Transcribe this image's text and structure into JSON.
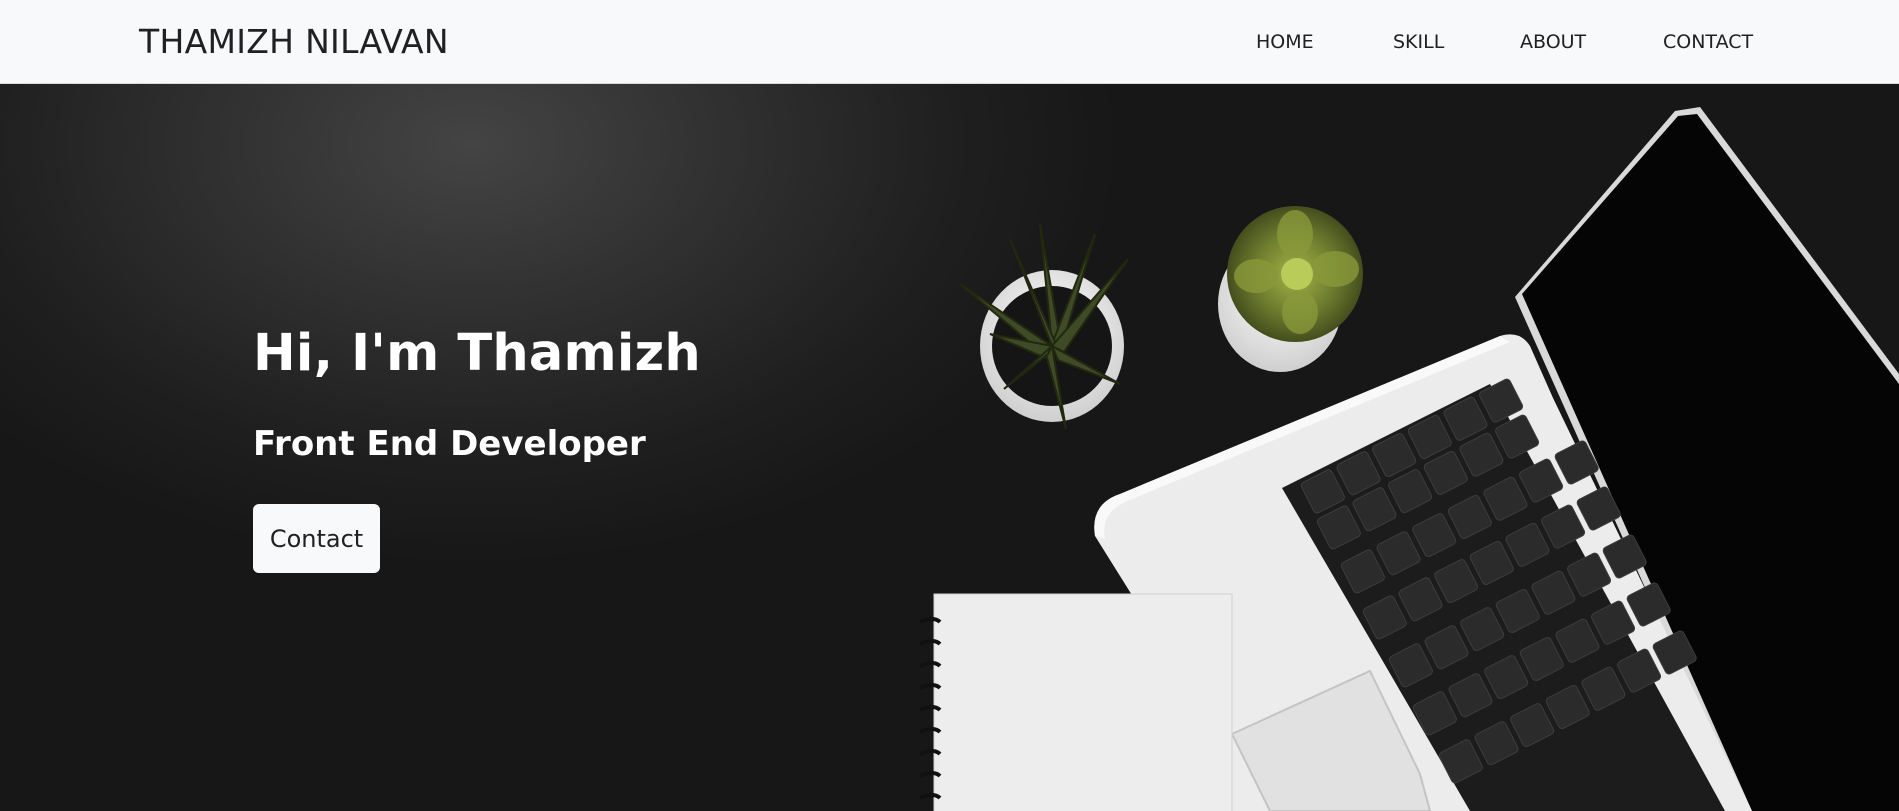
{
  "navbar": {
    "brand": "THAMIZH NILAVAN",
    "links": [
      {
        "label": "HOME"
      },
      {
        "label": "SKILL"
      },
      {
        "label": "ABOUT"
      },
      {
        "label": "CONTACT"
      }
    ]
  },
  "hero": {
    "title": "Hi, I'm Thamizh",
    "subtitle": "Front End Developer",
    "button_label": "Contact",
    "background_image": "dark desk with laptop, potted succulents and notebook"
  },
  "colors": {
    "navbar_bg": "#f8f9fa",
    "hero_bg": "#1f1f1f",
    "text_light": "#ffffff",
    "text_dark": "#212121"
  }
}
